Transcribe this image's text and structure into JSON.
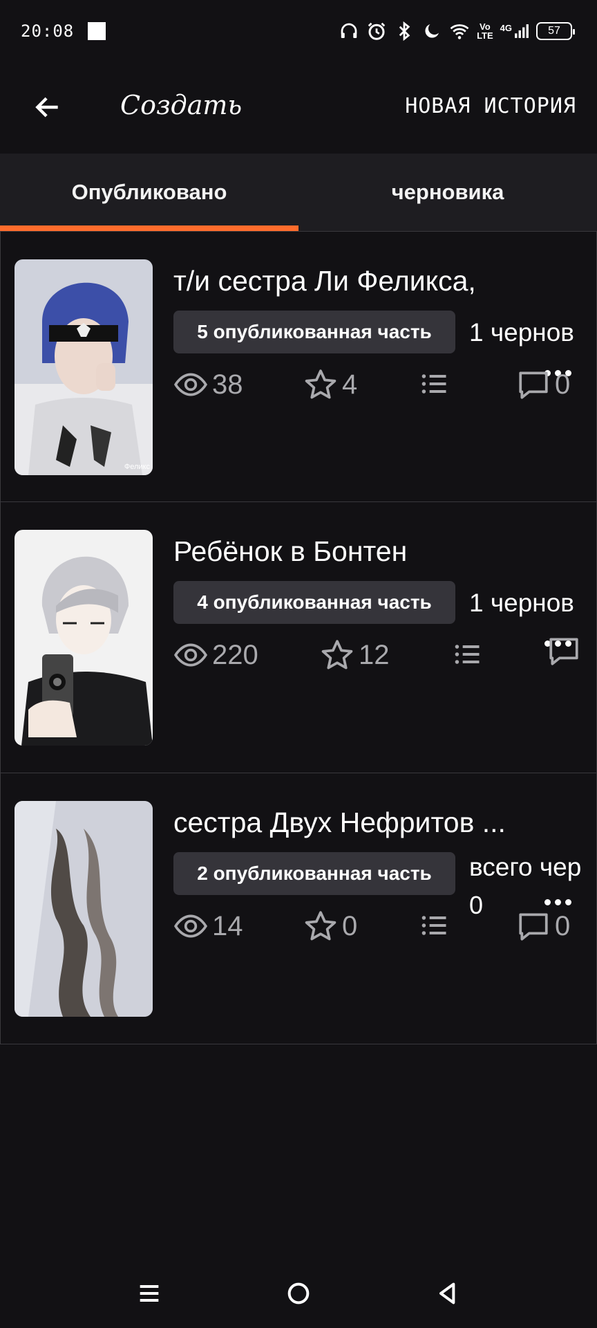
{
  "status_bar": {
    "time": "20:08",
    "network_vo": "Vo",
    "network_lte": "LTE",
    "network_4g": "4G",
    "battery": "57"
  },
  "app_bar": {
    "title": "Создать",
    "new_story_label": "НОВАЯ ИСТОРИЯ"
  },
  "tabs": [
    {
      "label": "Опубликовано",
      "active": true
    },
    {
      "label": "черновика",
      "active": false
    }
  ],
  "stories": [
    {
      "title": "т/и сестра Ли Феликса,",
      "published_parts": "5 опубликованная часть",
      "drafts": "1 чернов",
      "views": "38",
      "stars": "4",
      "comments": "0",
      "cover_caption": "Феликс"
    },
    {
      "title": "Ребёнок в Бонтен",
      "published_parts": "4 опубликованная часть",
      "drafts": "1 чернов",
      "views": "220",
      "stars": "12",
      "comments": ""
    },
    {
      "title": "сестра Двух Нефритов ...",
      "published_parts": "2 опубликованная часть",
      "drafts": "всего чер",
      "drafts_count": "0",
      "views": "14",
      "stars": "0",
      "comments": "0"
    }
  ],
  "colors": {
    "background": "#121114",
    "tab_bar": "#1e1d21",
    "accent": "#ff6c2c",
    "badge": "#35343a",
    "stat_text": "#a9a9ad"
  },
  "icons": [
    "headphones-icon",
    "alarm-icon",
    "bluetooth-icon",
    "moon-icon",
    "wifi-icon",
    "signal-icon",
    "eye-icon",
    "star-icon",
    "list-icon",
    "comment-icon",
    "more-icon",
    "back-arrow-icon",
    "menu-icon",
    "home-icon",
    "back-triangle-icon"
  ]
}
